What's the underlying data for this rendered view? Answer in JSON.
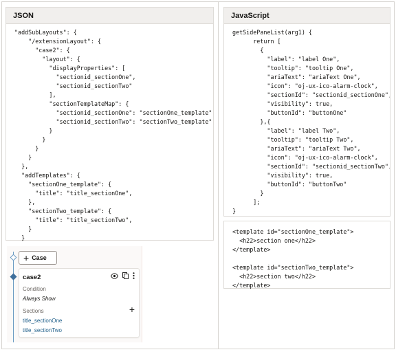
{
  "json_panel": {
    "title": "JSON",
    "code": "\"addSubLayouts\": {\n    \"/extensionLayout\": {\n      \"case2\": {\n        \"layout\": {\n          \"displayProperties\": [\n            \"sectionid_sectionOne\",\n            \"sectionid_sectionTwo\"\n          ],\n          \"sectionTemplateMap\": {\n            \"sectionid_sectionOne\": \"sectionOne_template\",\n            \"sectionid_sectionTwo\": \"sectionTwo_template\"\n          }\n        }\n      }\n    }\n  },\n  \"addTemplates\": {\n    \"sectionOne_template\": {\n      \"title\": \"title_sectionOne\",\n    },\n    \"sectionTwo_template\": {\n      \"title\": \"title_sectionTwo\",\n    }\n  }"
  },
  "js_panel": {
    "title": "JavaScript",
    "code": "getSidePaneList(arg1) {\n      return [\n        {\n          \"label\": \"label One\",\n          \"tooltip\": \"tooltip One\",\n          \"ariaText\": \"ariaText One\",\n          \"icon\": \"oj-ux-ico-alarm-clock\",\n          \"sectionId\": \"sectionid_sectionOne\",\n          \"visibility\": true,\n          \"buttonId\": \"buttonOne\"\n        },{\n          \"label\": \"label Two\",\n          \"tooltip\": \"tooltip Two\",\n          \"ariaText\": \"ariaText Two\",\n          \"icon\": \"oj-ux-ico-alarm-clock\",\n          \"sectionId\": \"sectionid_sectionTwo\",\n          \"visibility\": true,\n          \"buttonId\": \"buttonTwo\"\n        }\n      ];\n}"
  },
  "template_panel": {
    "code": "<template id=\"sectionOne_template\">\n  <h22>section one</h22>\n</template>\n\n<template id=\"sectionTwo_template\">\n  <h22>section two</h22>\n</template>"
  },
  "case_editor": {
    "add_case_label": "Case",
    "case_name": "case2",
    "condition_label": "Condition",
    "condition_value": "Always Show",
    "sections_label": "Sections",
    "sections": [
      "title_sectionOne",
      "title_sectionTwo"
    ],
    "icons": [
      "eye-icon",
      "copy-icon",
      "more-vertical-icon",
      "plus-icon"
    ]
  },
  "colors": {
    "header_bg": "#f1efed",
    "border": "#dedbd7",
    "link": "#1f5f8a",
    "connector": "#6b9bc3"
  }
}
